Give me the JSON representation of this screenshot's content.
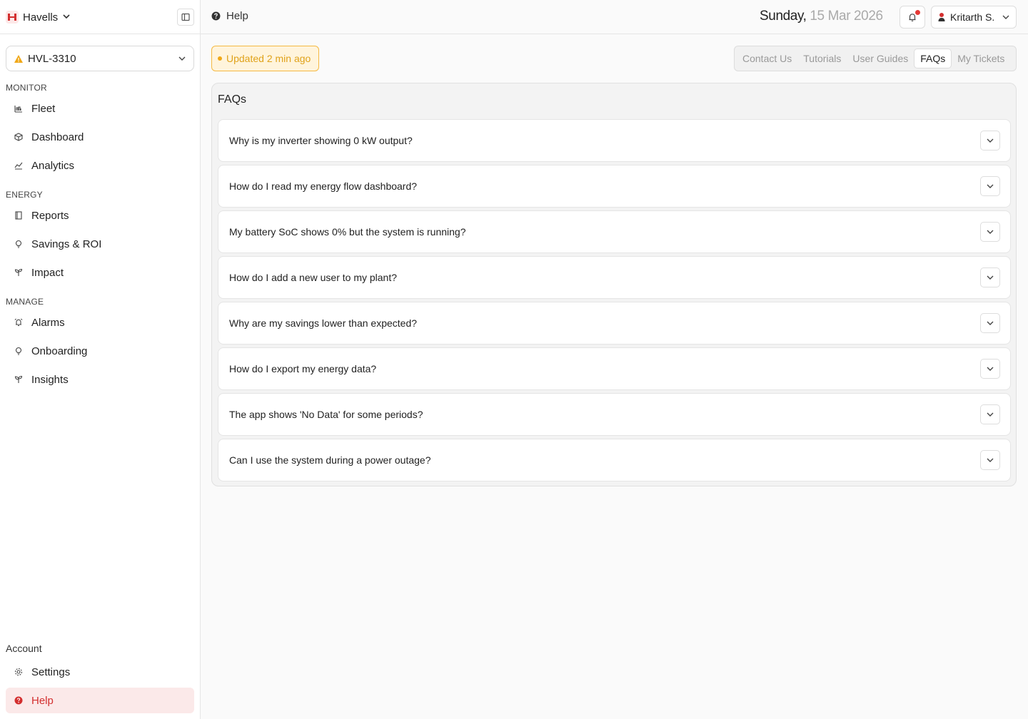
{
  "brand": {
    "name": "Havells",
    "accent": "#d32f2f"
  },
  "device": {
    "selected": "HVL-3310",
    "status_icon": "warning-icon"
  },
  "sidebar": {
    "sections": [
      {
        "title": "MONITOR",
        "items": [
          {
            "label": "Fleet",
            "icon": "fleet-icon"
          },
          {
            "label": "Dashboard",
            "icon": "cube-icon"
          },
          {
            "label": "Analytics",
            "icon": "chart-icon"
          }
        ]
      },
      {
        "title": "ENERGY",
        "items": [
          {
            "label": "Reports",
            "icon": "book-icon"
          },
          {
            "label": "Savings & ROI",
            "icon": "bulb-icon"
          },
          {
            "label": "Impact",
            "icon": "sprout-icon"
          }
        ]
      },
      {
        "title": "MANAGE",
        "items": [
          {
            "label": "Alarms",
            "icon": "alarm-icon"
          },
          {
            "label": "Onboarding",
            "icon": "bulb-icon"
          },
          {
            "label": "Insights",
            "icon": "sprout-icon"
          }
        ]
      }
    ],
    "account": {
      "title": "Account",
      "items": [
        {
          "label": "Settings",
          "icon": "gear-icon"
        },
        {
          "label": "Help",
          "icon": "help-icon",
          "active": true
        }
      ]
    }
  },
  "header": {
    "breadcrumb": "Help",
    "date_day": "Sunday,",
    "date_rest": " 15 Mar 2026",
    "user": "Kritarth S."
  },
  "status": {
    "text": "Updated 2 min ago",
    "color": "#f0a818"
  },
  "tabs": [
    {
      "label": "Contact Us",
      "active": false
    },
    {
      "label": "Tutorials",
      "active": false
    },
    {
      "label": "User Guides",
      "active": false
    },
    {
      "label": "FAQs",
      "active": true
    },
    {
      "label": "My Tickets",
      "active": false
    }
  ],
  "faq": {
    "title": "FAQs",
    "items": [
      "Why is my inverter showing 0 kW output?",
      "How do I read my energy flow dashboard?",
      "My battery SoC shows 0% but the system is running?",
      "How do I add a new user to my plant?",
      "Why are my savings lower than expected?",
      "How do I export my energy data?",
      "The app shows 'No Data' for some periods?",
      "Can I use the system during a power outage?"
    ]
  }
}
